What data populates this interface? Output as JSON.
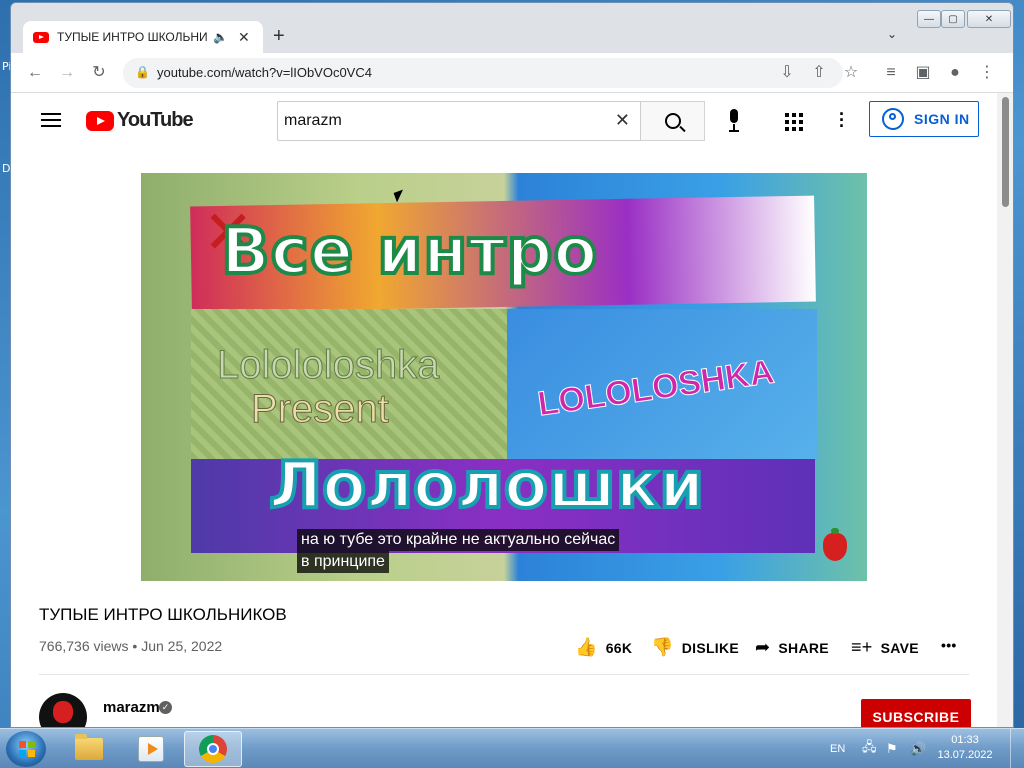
{
  "browser": {
    "tab_title": "ТУПЫЕ ИНТРО ШКОЛЬНИКОВ",
    "url": "youtube.com/watch?v=lIObVOc0VC4"
  },
  "desktop": {
    "left_edge_fragments": [
      "Pi",
      "D"
    ]
  },
  "youtube": {
    "logo_text": "YouTube",
    "search_value": "marazm",
    "sign_in_label": "SIGN IN"
  },
  "video": {
    "thumbnail_text": {
      "line1": "Все интро",
      "left_panel_1": "Lolololoshka",
      "left_panel_2": "Present",
      "right_panel": "LOLOLOSHKA",
      "line2": "Лололошки"
    },
    "captions": [
      "на ю тубе это крайне не актуально сейчас",
      "в принципе"
    ],
    "title": "ТУПЫЕ ИНТРО ШКОЛЬНИКОВ",
    "views": "766,736 views",
    "date": "Jun 25, 2022",
    "likes": "66K",
    "dislike_label": "DISLIKE",
    "share_label": "SHARE",
    "save_label": "SAVE"
  },
  "channel": {
    "name": "marazm",
    "subscribe_label": "SUBSCRIBE"
  },
  "taskbar": {
    "language": "EN",
    "time": "01:33",
    "date": "13.07.2022"
  },
  "colors": {
    "youtube_red": "#ff0000",
    "link_blue": "#065fd4",
    "subscribe_red": "#cc0000"
  }
}
